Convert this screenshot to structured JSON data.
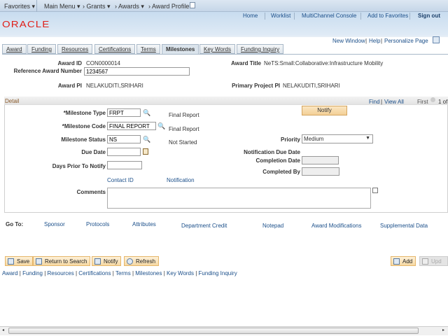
{
  "topnav": {
    "favorites": "Favorites ▾",
    "main_menu": "Main Menu ▾",
    "grants": "› Grants ▾",
    "awards": "› Awards ▾",
    "award_profile": "› Award Profile"
  },
  "header": {
    "logo": "ORACLE",
    "links": [
      "Home",
      "Worklist",
      "MultiChannel Console",
      "Add to Favorites",
      "Sign out"
    ]
  },
  "pagelinks": {
    "new_window": "New Window",
    "help": "Help",
    "personalize": "Personalize Page"
  },
  "tabs": [
    "Award",
    "Funding",
    "Resources",
    "Certifications",
    "Terms",
    "Milestones",
    "Key Words",
    "Funding Inquiry"
  ],
  "award": {
    "id_label": "Award ID",
    "id": "CON0000014",
    "title_label": "Award Title",
    "title": "NeTS:Small:Collaborative:Infrastructure Mobility",
    "ref_label": "Reference Award Number",
    "ref": "1234567",
    "pi_label": "Award PI",
    "pi": "NELAKUDITI,SRIHARI",
    "ppi_label": "Primary Project PI",
    "ppi": "NELAKUDITI,SRIHARI"
  },
  "detail": {
    "title": "Detail",
    "find": "Find",
    "view_all": "View All",
    "first": "First",
    "count": "1 of",
    "notify": "Notify",
    "milestone_type_label": "*Milestone Type",
    "milestone_type": "FRPT",
    "milestone_type_desc": "Final Report",
    "milestone_code_label": "*Milestone Code",
    "milestone_code": "FINAL REPORT",
    "milestone_code_desc": "Final Report",
    "status_label": "Milestone Status",
    "status": "NS",
    "status_desc": "Not Started",
    "priority_label": "Priority",
    "priority": "Medium",
    "due_label": "Due Date",
    "notif_due_label": "Notification Due Date",
    "completion_label": "Completion Date",
    "days_label": "Days Prior To Notify",
    "completed_by_label": "Completed By",
    "contact_id": "Contact ID",
    "notification": "Notification",
    "comments_label": "Comments"
  },
  "goto": {
    "label": "Go To:",
    "links": [
      "Sponsor",
      "Protocols",
      "Attributes",
      "Department Credit",
      "Notepad",
      "Award Modifications",
      "Supplemental Data"
    ]
  },
  "buttons": {
    "save": "Save",
    "return": "Return to Search",
    "notify": "Notify",
    "refresh": "Refresh",
    "add": "Add",
    "update": "Upd"
  },
  "bottomlinks": [
    "Award",
    "Funding",
    "Resources",
    "Certifications",
    "Terms",
    "Milestones",
    "Key Words",
    "Funding Inquiry"
  ]
}
